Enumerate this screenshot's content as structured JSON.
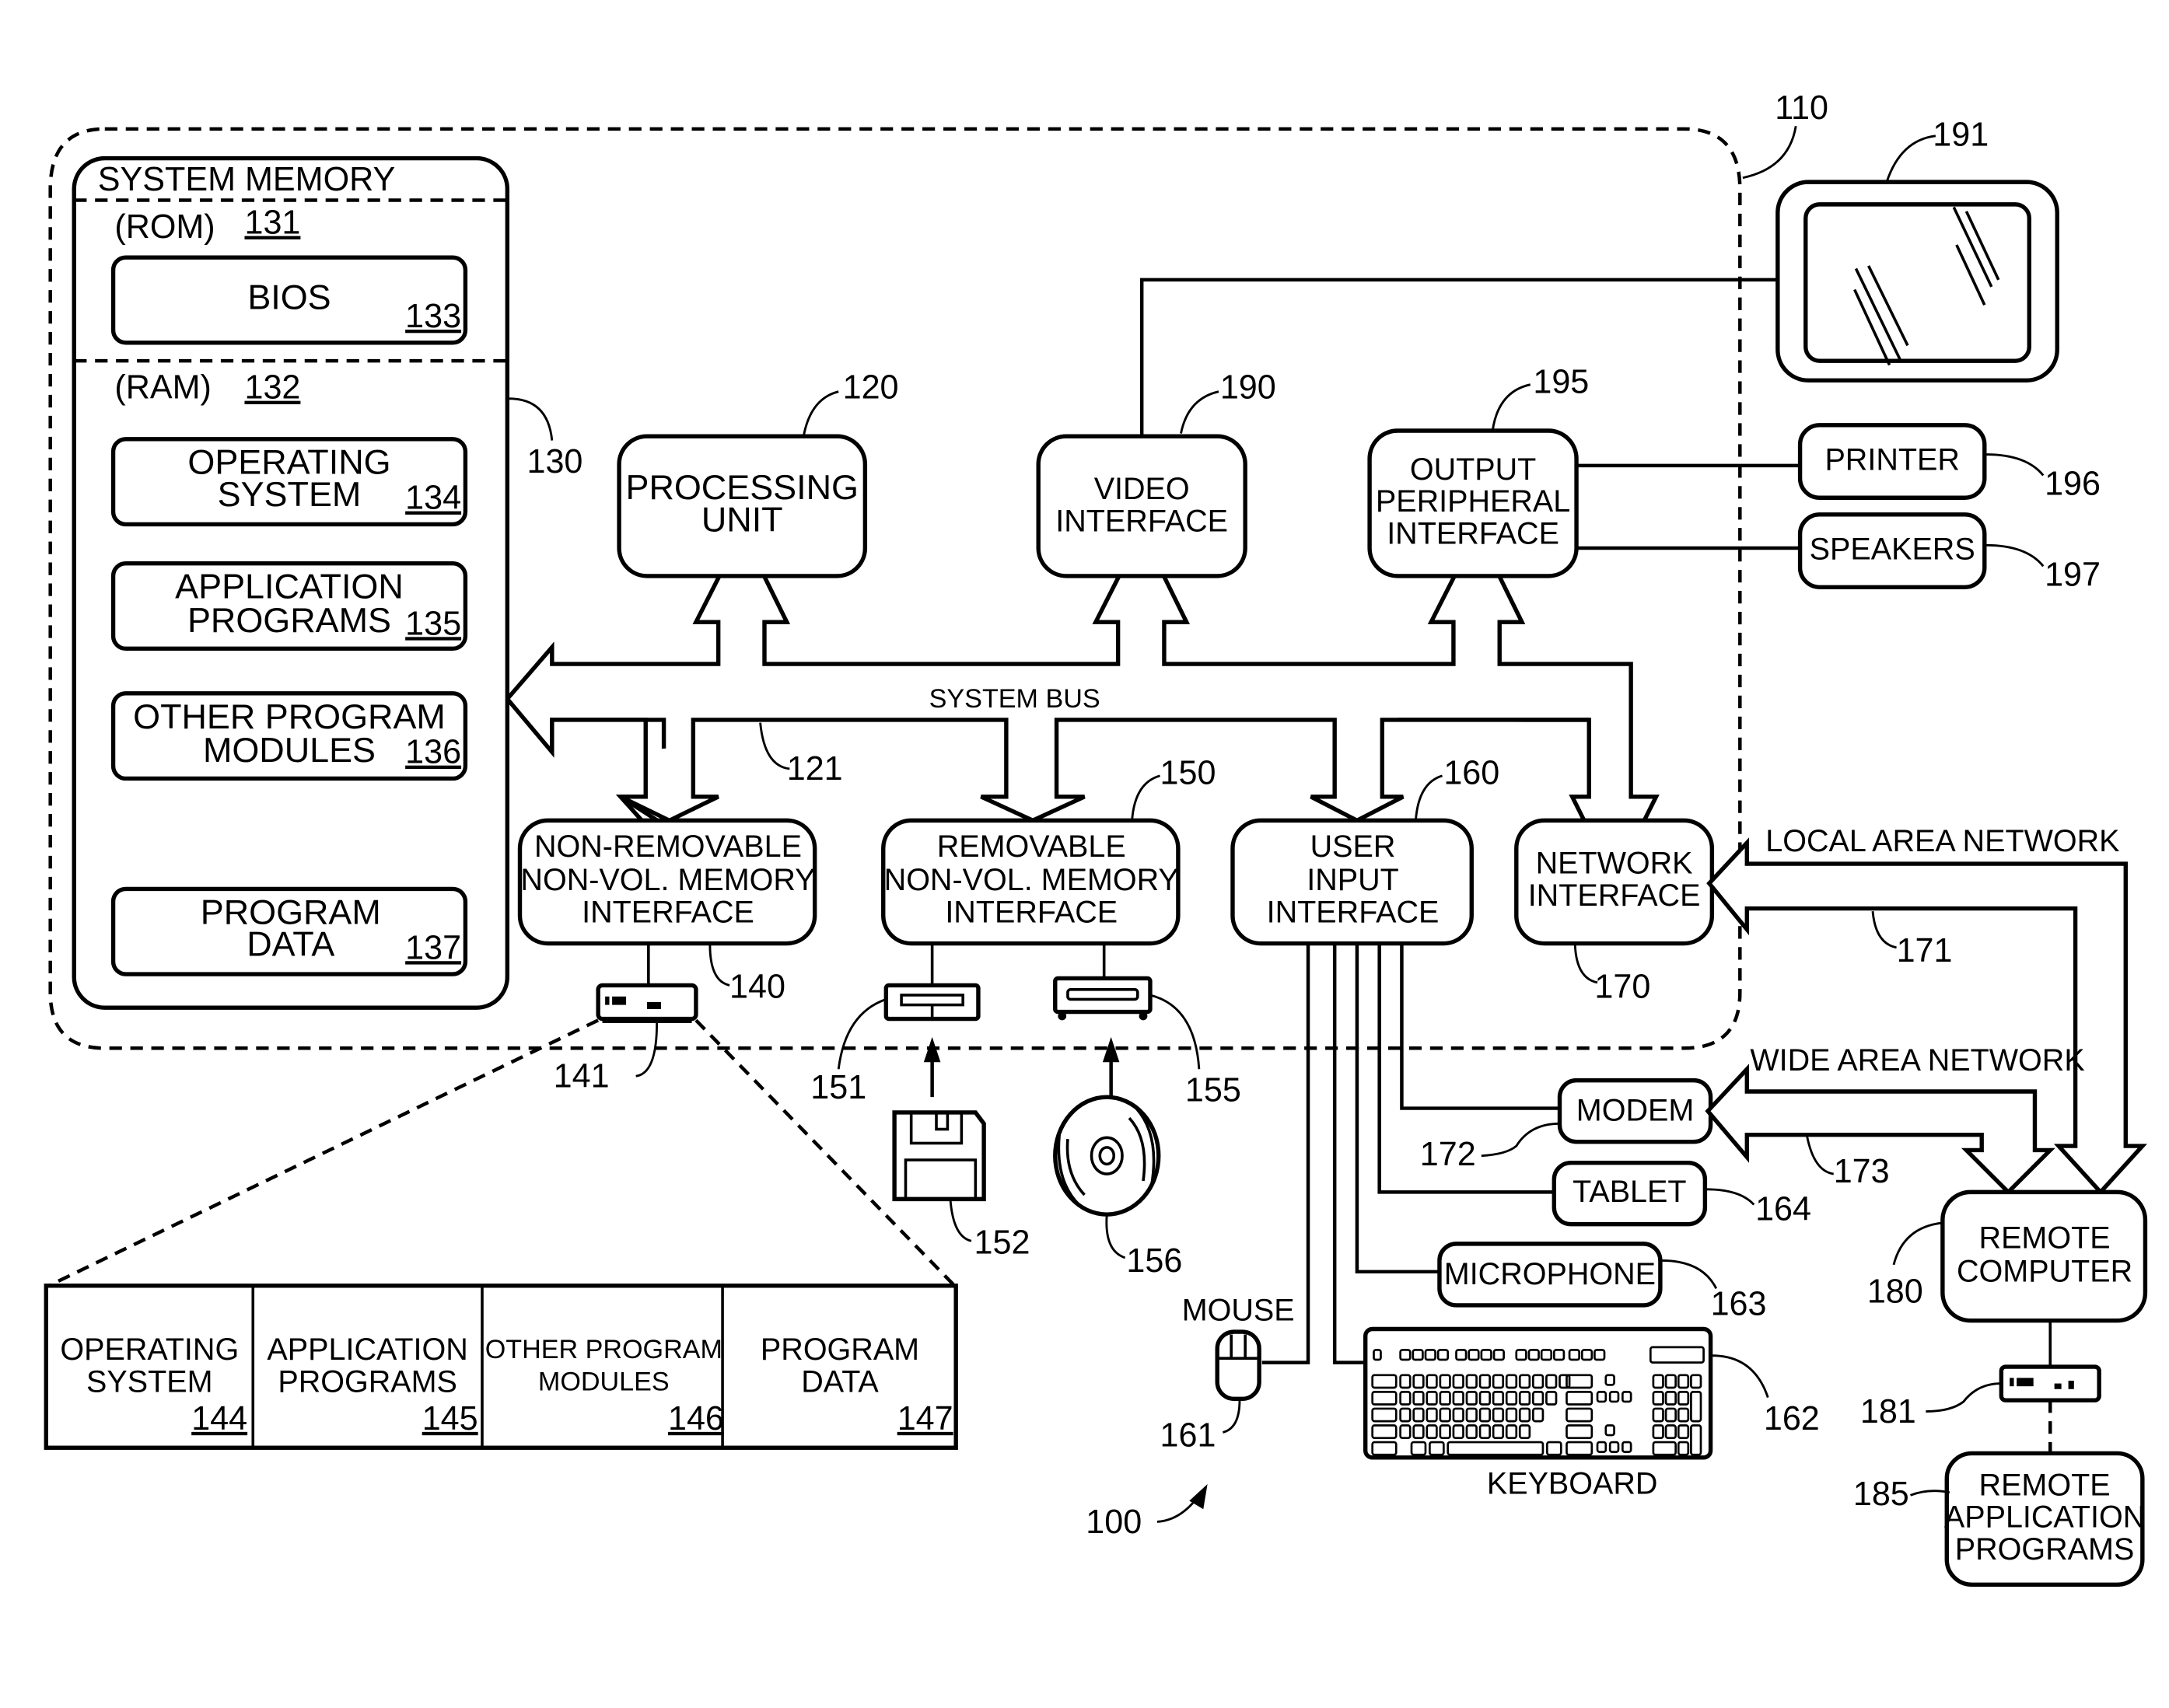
{
  "figure": {
    "figure_ref": "100",
    "computer_ref": "110"
  },
  "system_memory": {
    "title": "SYSTEM MEMORY",
    "ref": "130",
    "rom": {
      "label": "(ROM)",
      "ref": "131"
    },
    "ram": {
      "label": "(RAM)",
      "ref": "132"
    },
    "bios": {
      "line1": "BIOS",
      "ref": "133"
    },
    "operating_system": {
      "line1": "OPERATING",
      "line2": "SYSTEM",
      "ref": "134"
    },
    "application_programs": {
      "line1": "APPLICATION",
      "line2": "PROGRAMS",
      "ref": "135"
    },
    "other_program_modules": {
      "line1": "OTHER PROGRAM",
      "line2": "MODULES",
      "ref": "136"
    },
    "program_data": {
      "line1": "PROGRAM",
      "line2": "DATA",
      "ref": "137"
    }
  },
  "processing_unit": {
    "line1": "PROCESSING",
    "line2": "UNIT",
    "ref": "120"
  },
  "video_interface": {
    "line1": "VIDEO",
    "line2": "INTERFACE",
    "ref": "190"
  },
  "output_peripheral_interface": {
    "line1": "OUTPUT",
    "line2": "PERIPHERAL",
    "line3": "INTERFACE",
    "ref": "195"
  },
  "monitor": {
    "ref": "191"
  },
  "printer": {
    "label": "PRINTER",
    "ref": "196"
  },
  "speakers": {
    "label": "SPEAKERS",
    "ref": "197"
  },
  "system_bus": {
    "label": "SYSTEM BUS",
    "ref": "121"
  },
  "non_removable_interface": {
    "line1": "NON-REMOVABLE",
    "line2": "NON-VOL. MEMORY",
    "line3": "INTERFACE",
    "ref": "140"
  },
  "removable_interface": {
    "line1": "REMOVABLE",
    "line2": "NON-VOL. MEMORY",
    "line3": "INTERFACE",
    "ref": "150"
  },
  "user_input_interface": {
    "line1": "USER",
    "line2": "INPUT",
    "line3": "INTERFACE",
    "ref": "160"
  },
  "network_interface": {
    "line1": "NETWORK",
    "line2": "INTERFACE",
    "ref": "170"
  },
  "hard_disk": {
    "ref": "141"
  },
  "floppy_drive": {
    "ref": "151"
  },
  "floppy_disk": {
    "ref": "152"
  },
  "optical_drive": {
    "ref": "155"
  },
  "optical_disk": {
    "ref": "156"
  },
  "stored_items": [
    {
      "line1": "OPERATING",
      "line2": "SYSTEM",
      "ref": "144"
    },
    {
      "line1": "APPLICATION",
      "line2": "PROGRAMS",
      "ref": "145"
    },
    {
      "line1": "OTHER PROGRAM",
      "line2": "MODULES",
      "ref": "146"
    },
    {
      "line1": "PROGRAM",
      "line2": "DATA",
      "ref": "147"
    }
  ],
  "mouse": {
    "label": "MOUSE",
    "ref": "161"
  },
  "keyboard": {
    "label": "KEYBOARD",
    "ref": "162"
  },
  "microphone": {
    "label": "MICROPHONE",
    "ref": "163"
  },
  "tablet": {
    "label": "TABLET",
    "ref": "164"
  },
  "modem": {
    "label": "MODEM",
    "ref": "172"
  },
  "lan": {
    "label": "LOCAL AREA NETWORK",
    "ref": "171"
  },
  "wan": {
    "label": "WIDE AREA NETWORK",
    "ref": "173"
  },
  "remote_computer": {
    "line1": "REMOTE",
    "line2": "COMPUTER",
    "ref": "180"
  },
  "remote_storage": {
    "ref": "181"
  },
  "remote_application_programs": {
    "line1": "REMOTE",
    "line2": "APPLICATION",
    "line3": "PROGRAMS",
    "ref": "185"
  }
}
